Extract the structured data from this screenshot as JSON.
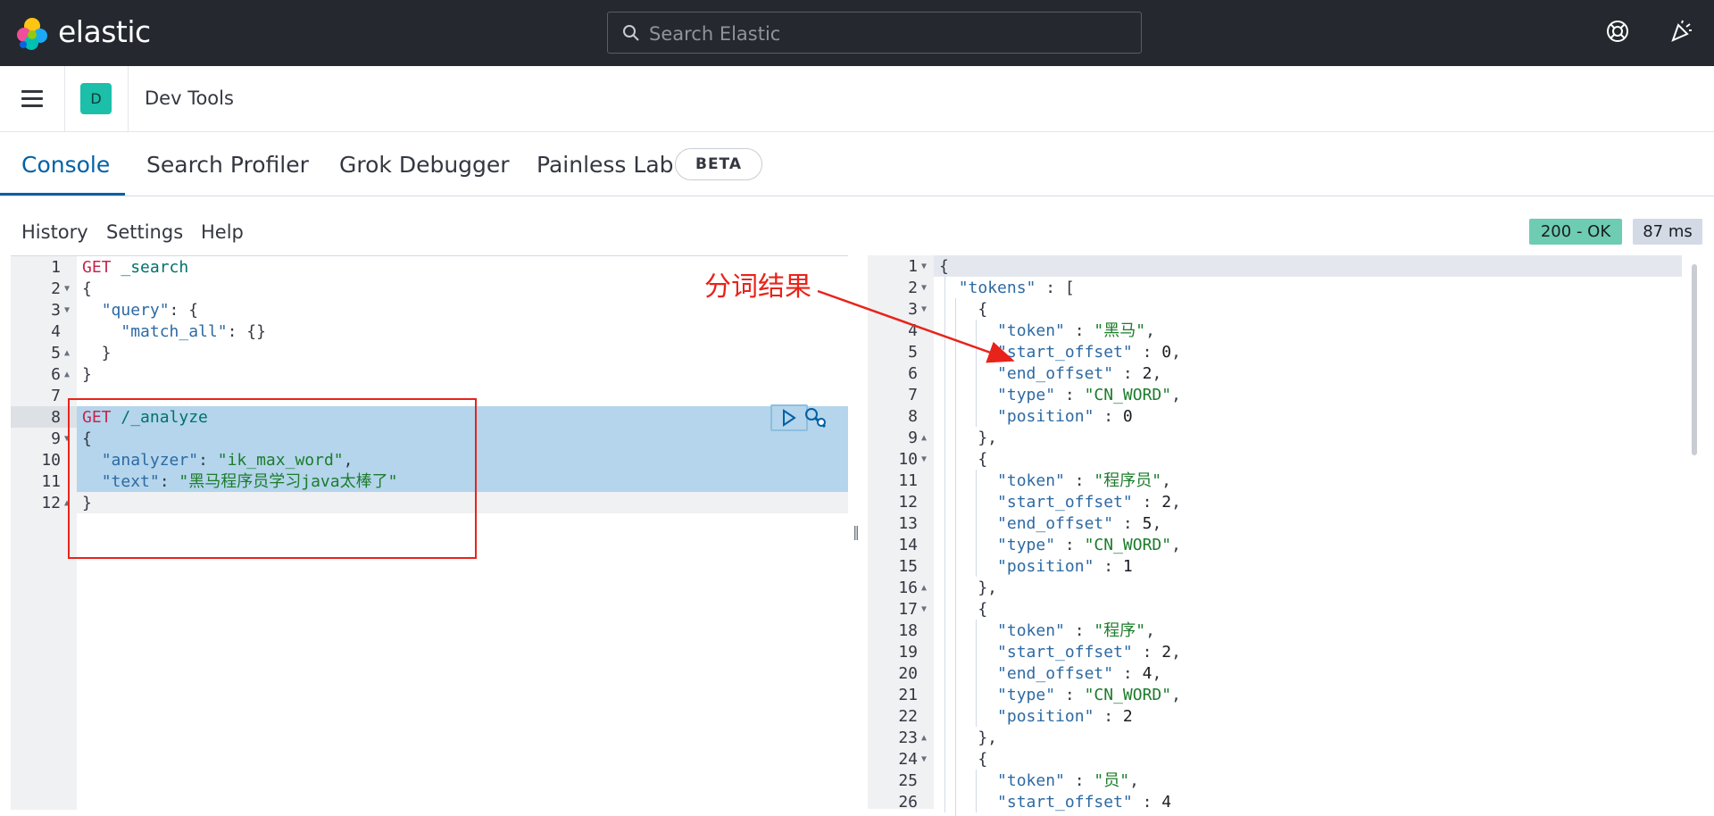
{
  "topbar": {
    "brand": "elastic",
    "search_placeholder": "Search Elastic"
  },
  "header": {
    "avatar_initial": "D",
    "breadcrumb": "Dev Tools"
  },
  "tabs": [
    {
      "label": "Console",
      "active": true
    },
    {
      "label": "Search Profiler",
      "active": false
    },
    {
      "label": "Grok Debugger",
      "active": false
    },
    {
      "label": "Painless Lab",
      "active": false
    }
  ],
  "beta_badge": "BETA",
  "toolbar": {
    "history": "History",
    "settings": "Settings",
    "help": "Help"
  },
  "status": {
    "code": "200 - OK",
    "time": "87 ms"
  },
  "annotation": "分词结果",
  "colors": {
    "topbar": "#25282f",
    "accent": "#0061a6",
    "avatar": "#1bbfaa",
    "status_ok": "#6dccb1",
    "annotation": "#e8231b"
  },
  "input_lines": [
    {
      "n": "1",
      "fold": "",
      "parts": [
        [
          "kw",
          "GET"
        ],
        [
          "punc",
          " "
        ],
        [
          "pt",
          "_search"
        ]
      ]
    },
    {
      "n": "2",
      "fold": "▼",
      "parts": [
        [
          "punc",
          "{"
        ]
      ]
    },
    {
      "n": "3",
      "fold": "▼",
      "parts": [
        [
          "punc",
          "  "
        ],
        [
          "prop",
          "\"query\""
        ],
        [
          "punc",
          ": {"
        ]
      ]
    },
    {
      "n": "4",
      "fold": "",
      "parts": [
        [
          "punc",
          "    "
        ],
        [
          "prop",
          "\"match_all\""
        ],
        [
          "punc",
          ": {}"
        ]
      ]
    },
    {
      "n": "5",
      "fold": "▲",
      "parts": [
        [
          "punc",
          "  }"
        ]
      ]
    },
    {
      "n": "6",
      "fold": "▲",
      "parts": [
        [
          "punc",
          "}"
        ]
      ]
    },
    {
      "n": "7",
      "fold": "",
      "parts": []
    },
    {
      "n": "8",
      "fold": "",
      "parts": [
        [
          "kw",
          "GET"
        ],
        [
          "punc",
          " "
        ],
        [
          "pt",
          "/_analyze"
        ]
      ]
    },
    {
      "n": "9",
      "fold": "▼",
      "parts": [
        [
          "punc",
          "{"
        ]
      ]
    },
    {
      "n": "10",
      "fold": "",
      "parts": [
        [
          "punc",
          "  "
        ],
        [
          "prop",
          "\"analyzer\""
        ],
        [
          "punc",
          ": "
        ],
        [
          "str",
          "\"ik_max_word\""
        ],
        [
          "punc",
          ","
        ]
      ]
    },
    {
      "n": "11",
      "fold": "",
      "parts": [
        [
          "punc",
          "  "
        ],
        [
          "prop",
          "\"text\""
        ],
        [
          "punc",
          ": "
        ],
        [
          "str",
          "\"黑马程序员学习java太棒了\""
        ]
      ]
    },
    {
      "n": "12",
      "fold": "▲",
      "parts": [
        [
          "punc",
          "}"
        ]
      ]
    }
  ],
  "output_lines": [
    {
      "n": "1",
      "fold": "▼",
      "parts": [
        [
          "punc",
          "{"
        ]
      ]
    },
    {
      "n": "2",
      "fold": "▼",
      "parts": [
        [
          "punc",
          "  "
        ],
        [
          "prop",
          "\"tokens\""
        ],
        [
          "punc",
          " : ["
        ]
      ]
    },
    {
      "n": "3",
      "fold": "▼",
      "parts": [
        [
          "punc",
          "    {"
        ]
      ]
    },
    {
      "n": "4",
      "fold": "",
      "parts": [
        [
          "punc",
          "      "
        ],
        [
          "prop",
          "\"token\""
        ],
        [
          "punc",
          " : "
        ],
        [
          "str",
          "\"黑马\""
        ],
        [
          "punc",
          ","
        ]
      ]
    },
    {
      "n": "5",
      "fold": "",
      "parts": [
        [
          "punc",
          "      "
        ],
        [
          "prop",
          "\"start_offset\""
        ],
        [
          "punc",
          " : "
        ],
        [
          "num",
          "0"
        ],
        [
          "punc",
          ","
        ]
      ]
    },
    {
      "n": "6",
      "fold": "",
      "parts": [
        [
          "punc",
          "      "
        ],
        [
          "prop",
          "\"end_offset\""
        ],
        [
          "punc",
          " : "
        ],
        [
          "num",
          "2"
        ],
        [
          "punc",
          ","
        ]
      ]
    },
    {
      "n": "7",
      "fold": "",
      "parts": [
        [
          "punc",
          "      "
        ],
        [
          "prop",
          "\"type\""
        ],
        [
          "punc",
          " : "
        ],
        [
          "str",
          "\"CN_WORD\""
        ],
        [
          "punc",
          ","
        ]
      ]
    },
    {
      "n": "8",
      "fold": "",
      "parts": [
        [
          "punc",
          "      "
        ],
        [
          "prop",
          "\"position\""
        ],
        [
          "punc",
          " : "
        ],
        [
          "num",
          "0"
        ]
      ]
    },
    {
      "n": "9",
      "fold": "▲",
      "parts": [
        [
          "punc",
          "    },"
        ]
      ]
    },
    {
      "n": "10",
      "fold": "▼",
      "parts": [
        [
          "punc",
          "    {"
        ]
      ]
    },
    {
      "n": "11",
      "fold": "",
      "parts": [
        [
          "punc",
          "      "
        ],
        [
          "prop",
          "\"token\""
        ],
        [
          "punc",
          " : "
        ],
        [
          "str",
          "\"程序员\""
        ],
        [
          "punc",
          ","
        ]
      ]
    },
    {
      "n": "12",
      "fold": "",
      "parts": [
        [
          "punc",
          "      "
        ],
        [
          "prop",
          "\"start_offset\""
        ],
        [
          "punc",
          " : "
        ],
        [
          "num",
          "2"
        ],
        [
          "punc",
          ","
        ]
      ]
    },
    {
      "n": "13",
      "fold": "",
      "parts": [
        [
          "punc",
          "      "
        ],
        [
          "prop",
          "\"end_offset\""
        ],
        [
          "punc",
          " : "
        ],
        [
          "num",
          "5"
        ],
        [
          "punc",
          ","
        ]
      ]
    },
    {
      "n": "14",
      "fold": "",
      "parts": [
        [
          "punc",
          "      "
        ],
        [
          "prop",
          "\"type\""
        ],
        [
          "punc",
          " : "
        ],
        [
          "str",
          "\"CN_WORD\""
        ],
        [
          "punc",
          ","
        ]
      ]
    },
    {
      "n": "15",
      "fold": "",
      "parts": [
        [
          "punc",
          "      "
        ],
        [
          "prop",
          "\"position\""
        ],
        [
          "punc",
          " : "
        ],
        [
          "num",
          "1"
        ]
      ]
    },
    {
      "n": "16",
      "fold": "▲",
      "parts": [
        [
          "punc",
          "    },"
        ]
      ]
    },
    {
      "n": "17",
      "fold": "▼",
      "parts": [
        [
          "punc",
          "    {"
        ]
      ]
    },
    {
      "n": "18",
      "fold": "",
      "parts": [
        [
          "punc",
          "      "
        ],
        [
          "prop",
          "\"token\""
        ],
        [
          "punc",
          " : "
        ],
        [
          "str",
          "\"程序\""
        ],
        [
          "punc",
          ","
        ]
      ]
    },
    {
      "n": "19",
      "fold": "",
      "parts": [
        [
          "punc",
          "      "
        ],
        [
          "prop",
          "\"start_offset\""
        ],
        [
          "punc",
          " : "
        ],
        [
          "num",
          "2"
        ],
        [
          "punc",
          ","
        ]
      ]
    },
    {
      "n": "20",
      "fold": "",
      "parts": [
        [
          "punc",
          "      "
        ],
        [
          "prop",
          "\"end_offset\""
        ],
        [
          "punc",
          " : "
        ],
        [
          "num",
          "4"
        ],
        [
          "punc",
          ","
        ]
      ]
    },
    {
      "n": "21",
      "fold": "",
      "parts": [
        [
          "punc",
          "      "
        ],
        [
          "prop",
          "\"type\""
        ],
        [
          "punc",
          " : "
        ],
        [
          "str",
          "\"CN_WORD\""
        ],
        [
          "punc",
          ","
        ]
      ]
    },
    {
      "n": "22",
      "fold": "",
      "parts": [
        [
          "punc",
          "      "
        ],
        [
          "prop",
          "\"position\""
        ],
        [
          "punc",
          " : "
        ],
        [
          "num",
          "2"
        ]
      ]
    },
    {
      "n": "23",
      "fold": "▲",
      "parts": [
        [
          "punc",
          "    },"
        ]
      ]
    },
    {
      "n": "24",
      "fold": "▼",
      "parts": [
        [
          "punc",
          "    {"
        ]
      ]
    },
    {
      "n": "25",
      "fold": "",
      "parts": [
        [
          "punc",
          "      "
        ],
        [
          "prop",
          "\"token\""
        ],
        [
          "punc",
          " : "
        ],
        [
          "str",
          "\"员\""
        ],
        [
          "punc",
          ","
        ]
      ]
    },
    {
      "n": "26",
      "fold": "",
      "parts": [
        [
          "punc",
          "      "
        ],
        [
          "prop",
          "\"start_offset\""
        ],
        [
          "punc",
          " : "
        ],
        [
          "num",
          "4"
        ]
      ]
    }
  ]
}
